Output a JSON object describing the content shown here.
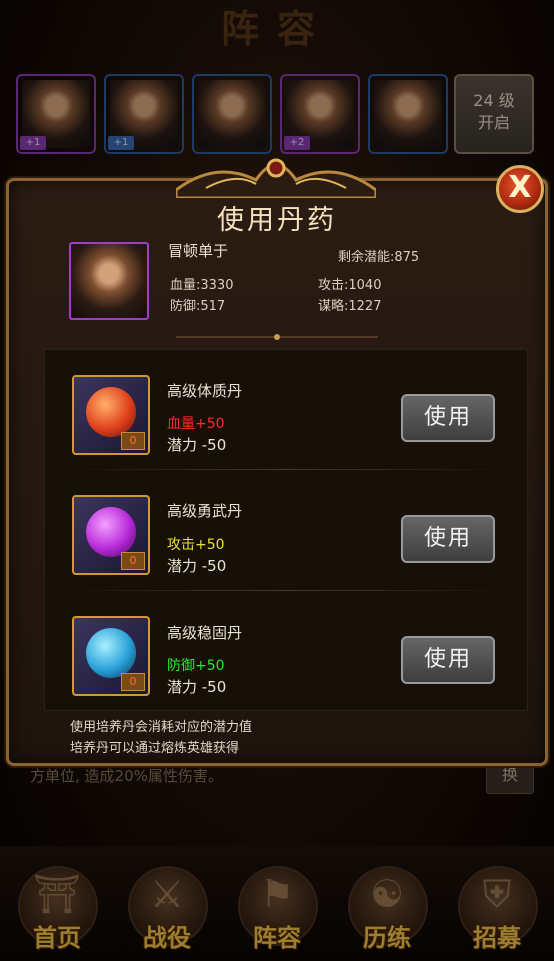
{
  "background": {
    "title": "阵容",
    "heroes": [
      {
        "name": "hero-slot-1",
        "badge": "+1",
        "border": "#8a3cb0",
        "badge_color": "#8a3cb0"
      },
      {
        "name": "hero-slot-2",
        "badge": "+1",
        "border": "#2a5a9a",
        "badge_color": "#3a6ab0"
      },
      {
        "name": "hero-slot-3",
        "badge": "",
        "border": "#2a5a9a",
        "badge_color": ""
      },
      {
        "name": "hero-slot-4",
        "badge": "+2",
        "border": "#8a3cb0",
        "badge_color": "#8a3cb0"
      },
      {
        "name": "hero-slot-5",
        "badge": "",
        "border": "#2a5a9a",
        "badge_color": ""
      }
    ],
    "locked_slot": {
      "line1": "24 级",
      "line2": "开启"
    },
    "skill_text": "方单位, 造成20%属性伤害。",
    "swap_label": "换"
  },
  "nav": [
    {
      "label": "首页",
      "icon": "palace-icon",
      "glyph": "⛩"
    },
    {
      "label": "战役",
      "icon": "crossed-swords-icon",
      "glyph": "⚔"
    },
    {
      "label": "阵容",
      "icon": "banner-icon",
      "glyph": "⚑"
    },
    {
      "label": "历练",
      "icon": "yin-yang-icon",
      "glyph": "☯"
    },
    {
      "label": "招募",
      "icon": "shield-icon",
      "glyph": "⛨"
    }
  ],
  "dialog": {
    "title": "使用丹药",
    "close_label": "X",
    "hero": {
      "name": "冒顿单于",
      "remaining_label": "剩余潜能:875",
      "hp": "血量:3330",
      "attack": "攻击:1040",
      "defense": "防御:517",
      "strategy": "谋略:1227"
    },
    "pills": [
      {
        "name": "高级体质丹",
        "effect": "血量+50",
        "effect_color": "#ff2a2a",
        "cost": "潜力  -50",
        "count": "0",
        "button": "使用",
        "orb_color": "#e0401c",
        "orb_light": "#ffb06a"
      },
      {
        "name": "高级勇武丹",
        "effect": "攻击+50",
        "effect_color": "#e8e23a",
        "cost": "潜力  -50",
        "count": "0",
        "button": "使用",
        "orb_color": "#b628d8",
        "orb_light": "#f4a0ff"
      },
      {
        "name": "高级稳固丹",
        "effect": "防御+50",
        "effect_color": "#2ee82e",
        "cost": "潜力  -50",
        "count": "0",
        "button": "使用",
        "orb_color": "#28a0d8",
        "orb_light": "#a8f0ff"
      }
    ],
    "hints": [
      "使用培养丹会消耗对应的潜力值",
      "培养丹可以通过熔炼英雄获得"
    ]
  }
}
